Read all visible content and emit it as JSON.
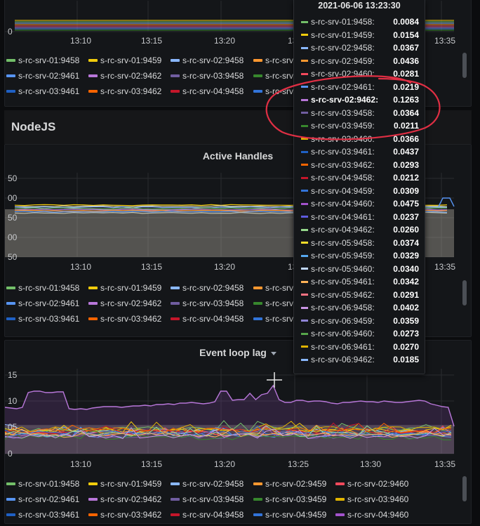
{
  "row": {
    "title": "NodeJS"
  },
  "time_ticks": [
    "13:10",
    "13:15",
    "13:20",
    "13:25",
    "13:30",
    "13:35"
  ],
  "panels": {
    "top": {
      "y_ticks": [
        "0"
      ]
    },
    "active_handles": {
      "title": "Active Handles",
      "y_ticks": [
        "50",
        "00",
        "50",
        "00",
        "50"
      ]
    },
    "event_loop_lag": {
      "title": "Event loop lag",
      "y_ticks": [
        "15",
        "10",
        "05",
        "0"
      ]
    }
  },
  "legend_rows": {
    "top": [
      [
        {
          "label": "s-rc-srv-01:9458",
          "color": "#73bf69"
        },
        {
          "label": "s-rc-srv-01:9459",
          "color": "#f2cc0c"
        },
        {
          "label": "s-rc-srv-02:9458",
          "color": "#8ab8ff"
        },
        {
          "label": "s-rc-srv-02:9459",
          "color": "#ff9830"
        }
      ],
      [
        {
          "label": "s-rc-srv-02:9461",
          "color": "#5794f2"
        },
        {
          "label": "s-rc-srv-02:9462",
          "color": "#b877d9"
        },
        {
          "label": "s-rc-srv-03:9458",
          "color": "#705da0"
        },
        {
          "label": "s-rc-srv",
          "color": "#37872d"
        }
      ],
      [
        {
          "label": "s-rc-srv-03:9461",
          "color": "#1f60c4"
        },
        {
          "label": "s-rc-srv-03:9462",
          "color": "#fa6400"
        },
        {
          "label": "s-rc-srv-04:9458",
          "color": "#c4162a"
        },
        {
          "label": "s-rc-srv",
          "color": "#3274d9"
        }
      ]
    ],
    "middle": [
      [
        {
          "label": "s-rc-srv-01:9458",
          "color": "#73bf69"
        },
        {
          "label": "s-rc-srv-01:9459",
          "color": "#f2cc0c"
        },
        {
          "label": "s-rc-srv-02:9458",
          "color": "#8ab8ff"
        },
        {
          "label": "s-rc-srv",
          "color": "#ff9830"
        }
      ],
      [
        {
          "label": "s-rc-srv-02:9461",
          "color": "#5794f2"
        },
        {
          "label": "s-rc-srv-02:9462",
          "color": "#b877d9"
        },
        {
          "label": "s-rc-srv-03:9458",
          "color": "#705da0"
        },
        {
          "label": "s-rc-srv",
          "color": "#37872d"
        }
      ],
      [
        {
          "label": "s-rc-srv-03:9461",
          "color": "#1f60c4"
        },
        {
          "label": "s-rc-srv-03:9462",
          "color": "#fa6400"
        },
        {
          "label": "s-rc-srv-04:9458",
          "color": "#c4162a"
        },
        {
          "label": "s-rc-srv",
          "color": "#3274d9"
        }
      ]
    ],
    "bottom": [
      [
        {
          "label": "s-rc-srv-01:9458",
          "color": "#73bf69"
        },
        {
          "label": "s-rc-srv-01:9459",
          "color": "#f2cc0c"
        },
        {
          "label": "s-rc-srv-02:9458",
          "color": "#8ab8ff"
        },
        {
          "label": "s-rc-srv-02:9459",
          "color": "#ff9830"
        },
        {
          "label": "s-rc-srv-02:9460",
          "color": "#f2495c"
        }
      ],
      [
        {
          "label": "s-rc-srv-02:9461",
          "color": "#5794f2"
        },
        {
          "label": "s-rc-srv-02:9462",
          "color": "#b877d9"
        },
        {
          "label": "s-rc-srv-03:9458",
          "color": "#705da0"
        },
        {
          "label": "s-rc-srv-03:9459",
          "color": "#37872d"
        },
        {
          "label": "s-rc-srv-03:9460",
          "color": "#e0b400"
        }
      ],
      [
        {
          "label": "s-rc-srv-03:9461",
          "color": "#1f60c4"
        },
        {
          "label": "s-rc-srv-03:9462",
          "color": "#fa6400"
        },
        {
          "label": "s-rc-srv-04:9458",
          "color": "#c4162a"
        },
        {
          "label": "s-rc-srv-04:9459",
          "color": "#3274d9"
        },
        {
          "label": "s-rc-srv-04:9460",
          "color": "#a352cc"
        }
      ]
    ]
  },
  "tooltip": {
    "time": "2021-06-06 13:23:30",
    "rows": [
      {
        "name": "s-rc-srv-01:9458:",
        "value": "0.0084",
        "color": "#73bf69"
      },
      {
        "name": "s-rc-srv-01:9459:",
        "value": "0.0154",
        "color": "#f2cc0c"
      },
      {
        "name": "s-rc-srv-02:9458:",
        "value": "0.0367",
        "color": "#8ab8ff"
      },
      {
        "name": "s-rc-srv-02:9459:",
        "value": "0.0436",
        "color": "#ff9830"
      },
      {
        "name": "s-rc-srv-02:9460:",
        "value": "0.0281",
        "color": "#f2495c"
      },
      {
        "name": "s-rc-srv-02:9461:",
        "value": "0.0219",
        "color": "#5794f2"
      },
      {
        "name": "s-rc-srv-02:9462:",
        "value": "0.1263",
        "color": "#b877d9",
        "highlight": true
      },
      {
        "name": "s-rc-srv-03:9458:",
        "value": "0.0364",
        "color": "#705da0"
      },
      {
        "name": "s-rc-srv-03:9459:",
        "value": "0.0211",
        "color": "#37872d"
      },
      {
        "name": "s-rc-srv-03:9460:",
        "value": "0.0366",
        "color": "#e0b400"
      },
      {
        "name": "s-rc-srv-03:9461:",
        "value": "0.0437",
        "color": "#1f60c4"
      },
      {
        "name": "s-rc-srv-03:9462:",
        "value": "0.0293",
        "color": "#fa6400"
      },
      {
        "name": "s-rc-srv-04:9458:",
        "value": "0.0212",
        "color": "#c4162a"
      },
      {
        "name": "s-rc-srv-04:9459:",
        "value": "0.0309",
        "color": "#3274d9"
      },
      {
        "name": "s-rc-srv-04:9460:",
        "value": "0.0475",
        "color": "#a352cc"
      },
      {
        "name": "s-rc-srv-04:9461:",
        "value": "0.0237",
        "color": "#5e5bdf"
      },
      {
        "name": "s-rc-srv-04:9462:",
        "value": "0.0260",
        "color": "#96d98d"
      },
      {
        "name": "s-rc-srv-05:9458:",
        "value": "0.0374",
        "color": "#fade2a"
      },
      {
        "name": "s-rc-srv-05:9459:",
        "value": "0.0329",
        "color": "#56a8f0"
      },
      {
        "name": "s-rc-srv-05:9460:",
        "value": "0.0340",
        "color": "#c0d8ff"
      },
      {
        "name": "s-rc-srv-05:9461:",
        "value": "0.0342",
        "color": "#ffb357"
      },
      {
        "name": "s-rc-srv-05:9462:",
        "value": "0.0291",
        "color": "#ff7383"
      },
      {
        "name": "s-rc-srv-06:9458:",
        "value": "0.0402",
        "color": "#ca95e5"
      },
      {
        "name": "s-rc-srv-06:9459:",
        "value": "0.0359",
        "color": "#8f84d6"
      },
      {
        "name": "s-rc-srv-06:9460:",
        "value": "0.0273",
        "color": "#56a64b"
      },
      {
        "name": "s-rc-srv-06:9461:",
        "value": "0.0270",
        "color": "#e0b400"
      },
      {
        "name": "s-rc-srv-06:9462:",
        "value": "0.0185",
        "color": "#8ab8ff"
      }
    ]
  },
  "annotation_color": "#e02f44"
}
